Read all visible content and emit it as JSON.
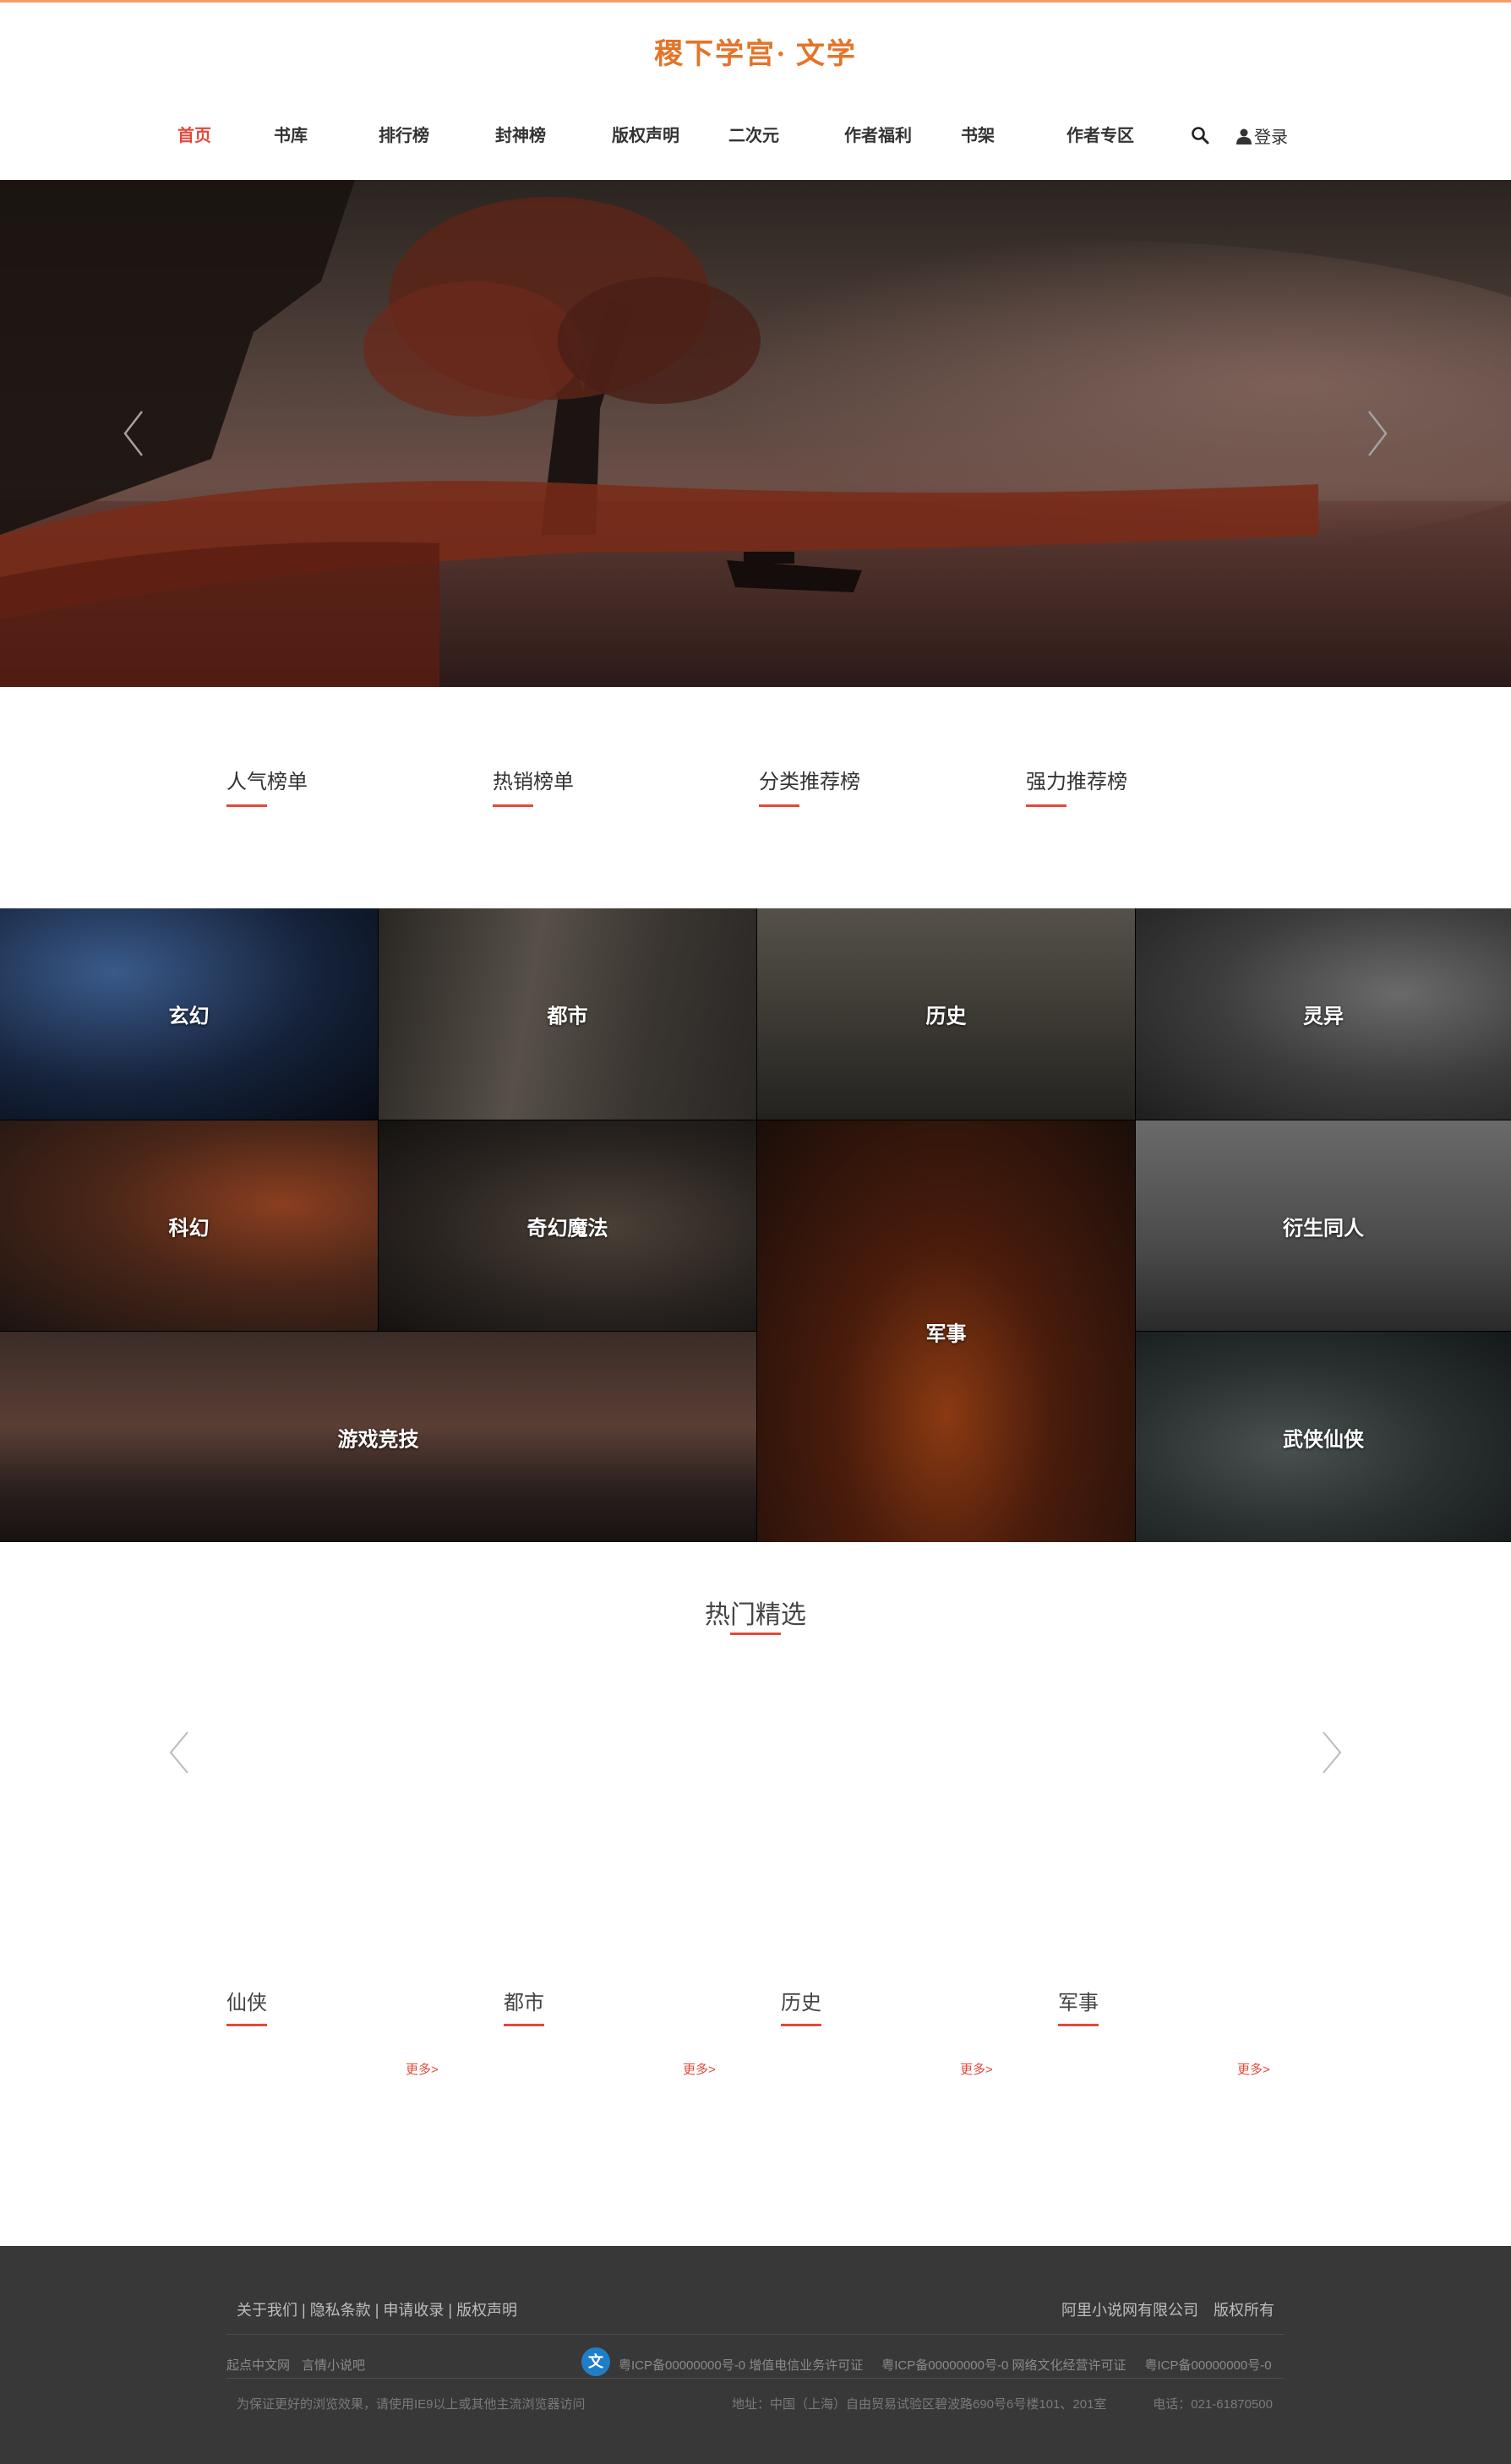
{
  "brand": {
    "logo_text": "稷下学宫· 文学",
    "accent_color": "#e2752a",
    "highlight_color": "#e04a3c"
  },
  "nav": {
    "items": [
      {
        "label": "首页",
        "active": true
      },
      {
        "label": "书库"
      },
      {
        "label": "排行榜"
      },
      {
        "label": "封神榜"
      },
      {
        "label": "版权声明"
      },
      {
        "label": "二次元"
      },
      {
        "label": "作者福利"
      },
      {
        "label": "书架"
      },
      {
        "label": "作者专区"
      }
    ],
    "search_icon": "search-icon",
    "login_label": "登录",
    "login_icon": "user-icon"
  },
  "banner": {
    "prev_icon": "chevron-left-icon",
    "next_icon": "chevron-right-icon"
  },
  "rank_tabs": [
    "人气榜单",
    "热销榜单",
    "分类推荐榜",
    "强力推荐榜"
  ],
  "categories": [
    {
      "label": "玄幻"
    },
    {
      "label": "都市"
    },
    {
      "label": "历史"
    },
    {
      "label": "灵异"
    },
    {
      "label": "科幻"
    },
    {
      "label": "奇幻魔法"
    },
    {
      "label": "军事"
    },
    {
      "label": "衍生同人"
    },
    {
      "label": "游戏竞技"
    },
    {
      "label": "武侠仙侠"
    }
  ],
  "hot": {
    "title": "热门精选",
    "prev_icon": "chevron-left-icon",
    "next_icon": "chevron-right-icon"
  },
  "genres": [
    {
      "label": "仙侠",
      "more": "更多>"
    },
    {
      "label": "都市",
      "more": "更多>"
    },
    {
      "label": "历史",
      "more": "更多>"
    },
    {
      "label": "军事",
      "more": "更多>"
    }
  ],
  "footer": {
    "links": [
      "关于我们",
      "隐私条款",
      "申请收录",
      "版权声明"
    ],
    "company": "阿里小说网有限公司",
    "rights": "版权所有",
    "partners": [
      "起点中文网",
      "言情小说吧"
    ],
    "badge_glyph": "文",
    "icp": [
      "粤ICP备00000000号-0 增值电信业务许可证",
      "粤ICP备00000000号-0 网络文化经营许可证",
      "粤ICP备00000000号-0"
    ],
    "browser_note": "为保证更好的浏览效果，请使用IE9以上或其他主流浏览器访问",
    "address": "地址：中国（上海）自由贸易试验区碧波路690号6号楼101、201室",
    "phone": "电话：021-61870500"
  }
}
